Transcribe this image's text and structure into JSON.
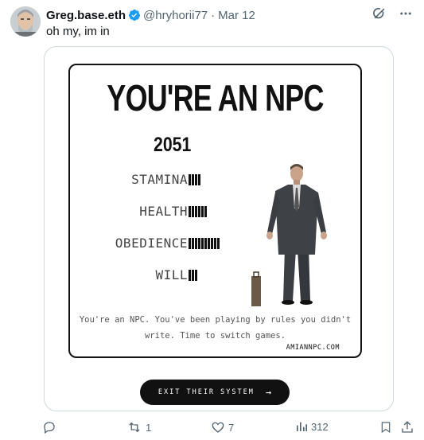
{
  "tweet": {
    "author_name": "Greg.base.eth",
    "handle": "@hryhorii77",
    "separator": "·",
    "date": "Mar 12",
    "text": "oh my, im in"
  },
  "card": {
    "title": "YOU'RE AN NPC",
    "year": "2051",
    "stats": [
      {
        "label": "STAMINA",
        "level": 4
      },
      {
        "label": "HEALTH",
        "level": 6
      },
      {
        "label": "OBEDIENCE",
        "level": 10
      },
      {
        "label": "WILL",
        "level": 3
      }
    ],
    "description": "You're an NPC. You've been playing by rules you didn't write. Time to switch games.",
    "site": "AMIANNPC.COM",
    "button_label": "EXIT THEIR SYSTEM",
    "button_arrow": "→"
  },
  "actions": {
    "replies": "",
    "reposts": "1",
    "likes": "7",
    "views": "312"
  },
  "colors": {
    "secondary_text": "#536471",
    "verified_blue": "#1d9bf0",
    "card_border": "#cfd9de",
    "button_bg": "#111111"
  },
  "icons": [
    "avatar",
    "verified-badge-icon",
    "grok-icon",
    "more-icon",
    "reply-icon",
    "repost-icon",
    "like-icon",
    "views-icon",
    "bookmark-icon",
    "share-icon"
  ]
}
